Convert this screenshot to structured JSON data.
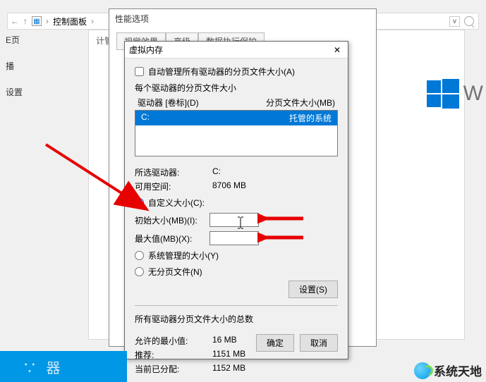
{
  "cp": {
    "crumb": "控制面板",
    "left": {
      "home": "E页",
      "item2": "播",
      "item3": "设置"
    },
    "perf_tab_left_label": "计管"
  },
  "perf": {
    "title": "性能选项",
    "tabs": [
      "视觉效果",
      "高级",
      "数据执行保护"
    ]
  },
  "vm": {
    "title": "虚拟内存",
    "auto_label": "自动管理所有驱动器的分页文件大小(A)",
    "each_drive_label": "每个驱动器的分页文件大小",
    "col_drive": "驱动器 [卷标](D)",
    "col_size": "分页文件大小(MB)",
    "drives": [
      {
        "name": "C:",
        "value": "托管的系统"
      }
    ],
    "selected_drive_label": "所选驱动器:",
    "selected_drive_value": "C:",
    "free_label": "可用空间:",
    "free_value": "8706 MB",
    "custom_label": "自定义大小(C):",
    "initial_label": "初始大小(MB)(I):",
    "initial_value": "",
    "max_label": "最大值(MB)(X):",
    "max_value": "",
    "sysman_label": "系统管理的大小(Y)",
    "none_label": "无分页文件(N)",
    "set_btn": "设置(S)",
    "totals_label": "所有驱动器分页文件大小的总数",
    "min_label": "允许的最小值:",
    "min_value": "16 MB",
    "rec_label": "推荐:",
    "rec_value": "1151 MB",
    "cur_label": "当前已分配:",
    "cur_value": "1152 MB",
    "ok": "确定",
    "cancel": "取消"
  },
  "winmark_letter": "W",
  "taskbar_text": "∵ 器",
  "watermark": "系统天地"
}
